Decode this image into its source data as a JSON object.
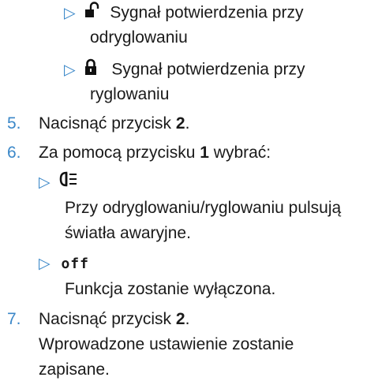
{
  "colors": {
    "accent": "#3a87c8",
    "text": "#1a1a1a"
  },
  "bullets": {
    "unlock_signal": {
      "icon": "unlock-icon",
      "line1": "Sygnał potwierdzenia przy",
      "line2": "odryglowaniu"
    },
    "lock_signal": {
      "icon": "lock-icon",
      "line1": "Sygnał potwierdzenia przy",
      "line2": "ryglowaniu"
    }
  },
  "steps": {
    "s5": {
      "number": "5.",
      "text": "Nacisnąć przycisk ",
      "bold": "2",
      "end": "."
    },
    "s6": {
      "number": "6.",
      "text": "Za pomocą przycisku ",
      "bold": "1",
      "end": " wybrać:"
    },
    "s7": {
      "number": "7.",
      "text": "Nacisnąć przycisk ",
      "bold": "2",
      "end": ".",
      "line2": "Wprowadzone ustawienie zostanie",
      "line3": "zapisane."
    }
  },
  "options": {
    "hazard": {
      "icon": "hazard-lights-icon",
      "line1": "Przy odryglowaniu/ryglowaniu pulsują",
      "line2": "światła awaryjne."
    },
    "off": {
      "display": "off",
      "line1": "Funkcja zostanie wyłączona."
    }
  },
  "triangle_glyph": "▷"
}
